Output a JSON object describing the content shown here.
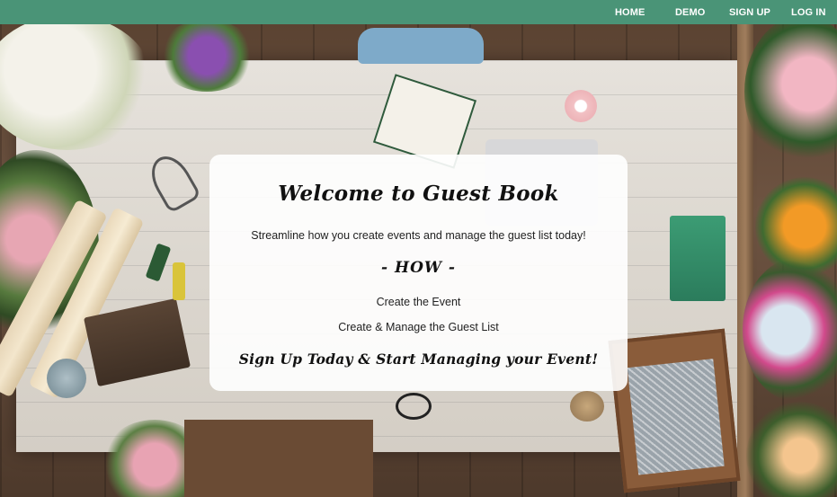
{
  "nav": {
    "home": "HOME",
    "demo": "DEMO",
    "signup": "SIGN UP",
    "login": "LOG IN"
  },
  "welcome": {
    "title": "Welcome to Guest Book",
    "tagline": "Streamline how you create events and manage the guest list today!",
    "how_heading": "- HOW -",
    "steps": [
      "Create the Event",
      "Create & Manage the Guest List"
    ],
    "cta": "Sign Up Today & Start Managing your Event!"
  },
  "colors": {
    "navbar": "#4a9477",
    "nav_text": "#ffffff",
    "card_bg": "#ffffff"
  }
}
